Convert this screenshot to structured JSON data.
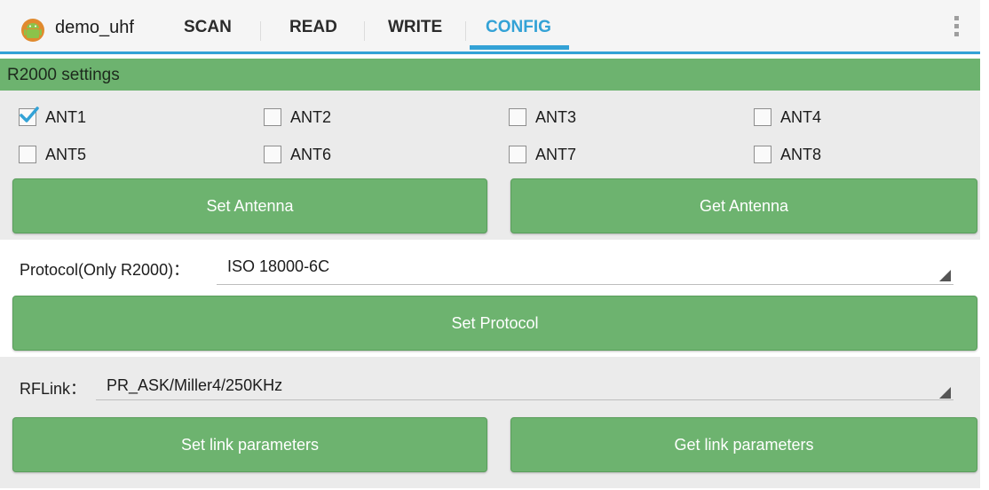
{
  "app": {
    "title": "demo_uhf",
    "tabs": [
      {
        "label": "SCAN",
        "active": false
      },
      {
        "label": "READ",
        "active": false
      },
      {
        "label": "WRITE",
        "active": false
      },
      {
        "label": "CONFIG",
        "active": true
      }
    ]
  },
  "r2000": {
    "header": "R2000 settings",
    "antennas": [
      {
        "label": "ANT1",
        "checked": true
      },
      {
        "label": "ANT2",
        "checked": false
      },
      {
        "label": "ANT3",
        "checked": false
      },
      {
        "label": "ANT4",
        "checked": false
      },
      {
        "label": "ANT5",
        "checked": false
      },
      {
        "label": "ANT6",
        "checked": false
      },
      {
        "label": "ANT7",
        "checked": false
      },
      {
        "label": "ANT8",
        "checked": false
      }
    ],
    "set_antenna": "Set Antenna",
    "get_antenna": "Get Antenna"
  },
  "protocol": {
    "label": "Protocol(Only R2000)：",
    "value": "ISO 18000-6C",
    "set_button": "Set Protocol"
  },
  "rflink": {
    "label": "RFLink：",
    "value": "PR_ASK/Miller4/250KHz",
    "set_button": "Set link parameters",
    "get_button": "Get link parameters"
  },
  "colors": {
    "accent": "#33a2d6",
    "button_green": "#6db36f",
    "panel_gray": "#ebebeb"
  }
}
